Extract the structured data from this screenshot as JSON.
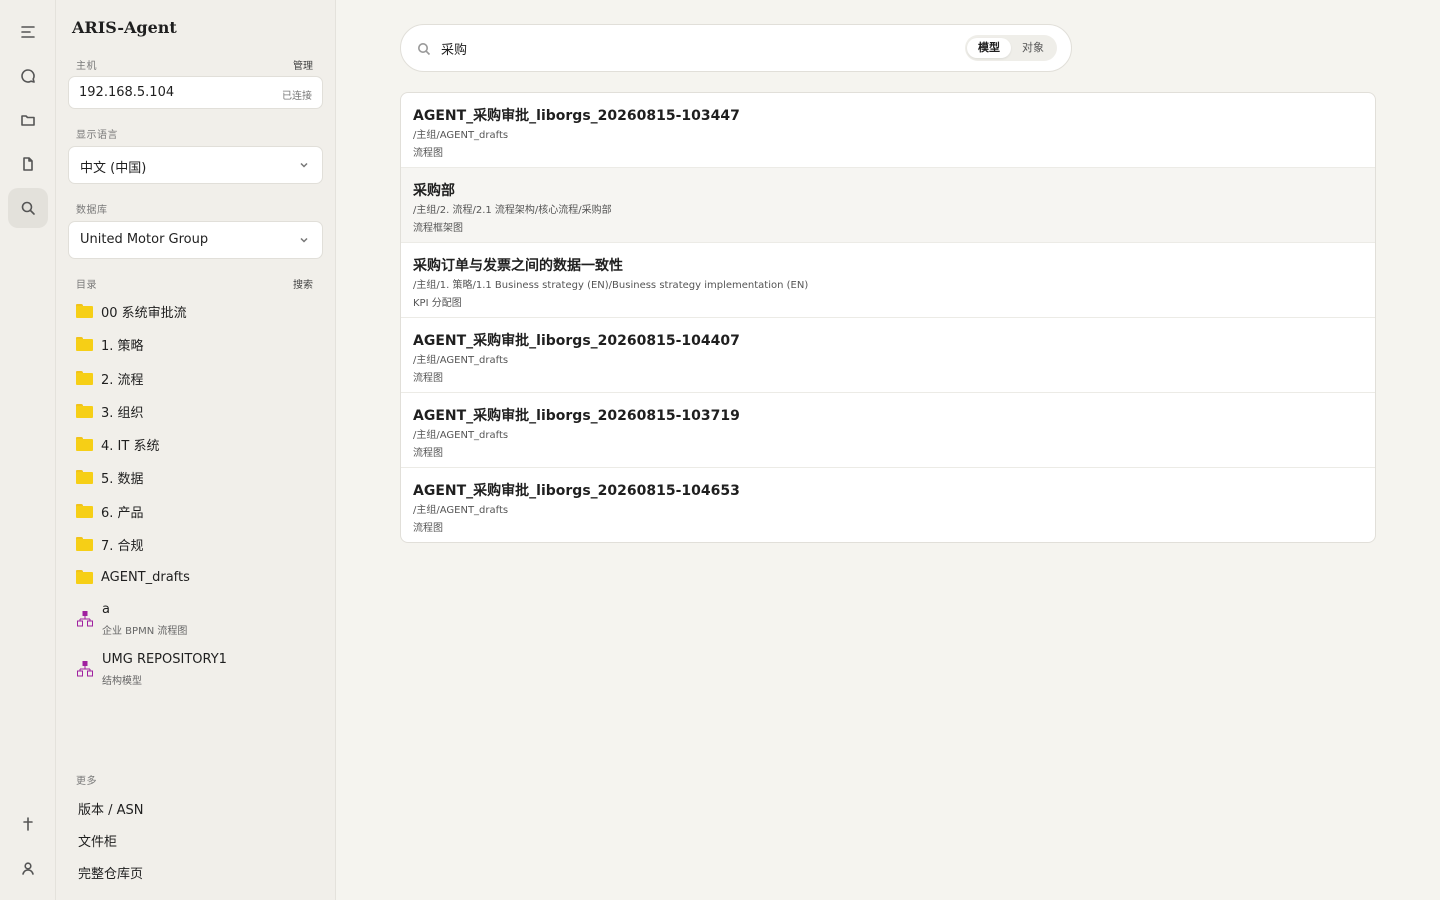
{
  "app": {
    "title": "ARIS-Agent"
  },
  "rail": {
    "icons": [
      "menu-icon",
      "chat-icon",
      "folder-icon",
      "document-icon",
      "search-icon",
      "pin-icon",
      "user-icon"
    ]
  },
  "sidebar": {
    "host_label": "主机",
    "host_action": "管理",
    "host_value": "192.168.5.104",
    "host_status": "已连接",
    "language_label": "显示语言",
    "language_value": "中文 (中国)",
    "database_label": "数据库",
    "database_value": "United Motor Group",
    "catalog_label": "目录",
    "catalog_action": "搜索",
    "folders": [
      "00 系统审批流",
      "1. 策略",
      "2. 流程",
      "3. 组织",
      "4. IT 系统",
      "5. 数据",
      "6. 产品",
      "7. 合规",
      "AGENT_drafts"
    ],
    "models": [
      {
        "title": "a",
        "sub": "企业 BPMN 流程图"
      },
      {
        "title": "UMG REPOSITORY1",
        "sub": "结构模型"
      }
    ],
    "more_label": "更多",
    "more_links": [
      "版本 / ASN",
      "文件柜",
      "完整仓库页"
    ]
  },
  "search": {
    "value": "采购",
    "toggle_model": "模型",
    "toggle_object": "对象"
  },
  "results": [
    {
      "title": "AGENT_采购审批_liborgs_20260815-103447",
      "path": "/主组/AGENT_drafts",
      "type": "流程图"
    },
    {
      "title": "采购部",
      "path": "/主组/2. 流程/2.1 流程架构/核心流程/采购部",
      "type": "流程框架图"
    },
    {
      "title": "采购订单与发票之间的数据一致性",
      "path": "/主组/1. 策略/1.1 Business strategy (EN)/Business strategy implementation (EN)",
      "type": "KPI 分配图"
    },
    {
      "title": "AGENT_采购审批_liborgs_20260815-104407",
      "path": "/主组/AGENT_drafts",
      "type": "流程图"
    },
    {
      "title": "AGENT_采购审批_liborgs_20260815-103719",
      "path": "/主组/AGENT_drafts",
      "type": "流程图"
    },
    {
      "title": "AGENT_采购审批_liborgs_20260815-104653",
      "path": "/主组/AGENT_drafts",
      "type": "流程图"
    }
  ],
  "colors": {
    "background": "#f5f4ef",
    "sidebar": "#f1efea",
    "folder": "#f6cf16",
    "model_icon": "#a020a0"
  }
}
